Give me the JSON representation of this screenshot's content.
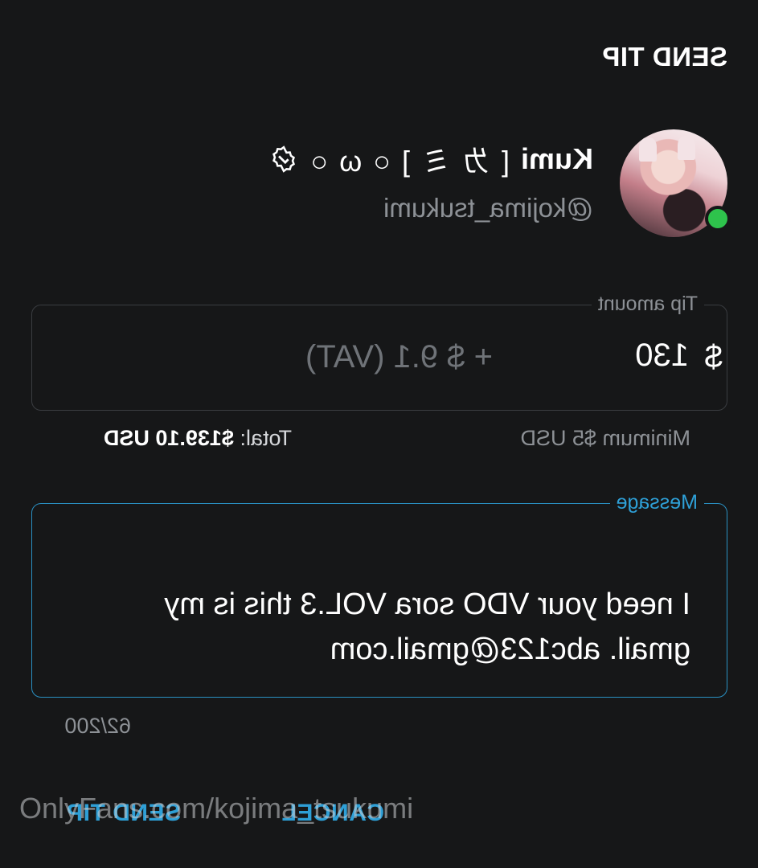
{
  "dialog": {
    "title": "SEND TIP"
  },
  "creator": {
    "name": "Kumi",
    "name_decoration": "[ ㄌ ミ ] ○ ω ○",
    "handle": "@kojima_tsukumi",
    "online": true,
    "verified": true
  },
  "tip": {
    "label": "Tip amount",
    "currency_symbol": "$",
    "amount": "130",
    "vat_text": "+ $ 9.1 (VAT)",
    "minimum_text": "Minimum $5 USD",
    "total_label": "Total:",
    "total_value": "$139.10 USD"
  },
  "message": {
    "label": "Message",
    "line1": "I need your VDO sora VOL.3 this is my",
    "line2": "gmail. abc123@gmail.com",
    "counter": "62/200"
  },
  "actions": {
    "cancel_label": "CANCEL",
    "send_label": "SEND TIP"
  },
  "watermark": "OnlyFans.com/kojima_tsukumi",
  "colors": {
    "background": "#161718",
    "accent": "#2e9fd6",
    "online": "#2ec34c",
    "muted": "#8d9196"
  }
}
